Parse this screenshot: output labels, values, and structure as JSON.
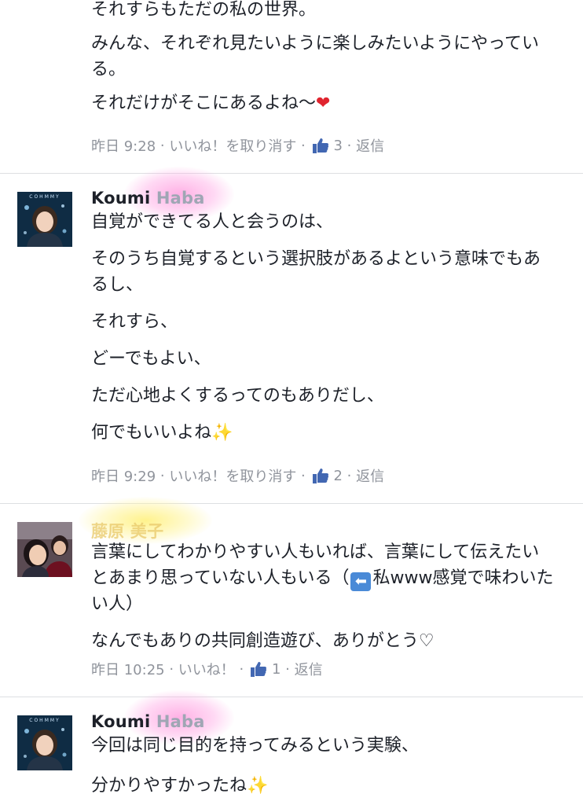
{
  "comments": [
    {
      "author": "",
      "lines": [
        "それすらもただの私の世界。",
        "みんな、それぞれ見たいように楽しみたいようにやっている。",
        "それだけがそこにあるよね〜"
      ],
      "time": "昨日 9:28",
      "like_action": "いいね！を取り消す",
      "like_count": "3",
      "reply": "返信"
    },
    {
      "author_first": "Koumi",
      "author_rest": "Haba",
      "lines": [
        "自覚ができてる人と会うのは、",
        "そのうち自覚するという選択肢があるよという意味でもあるし、",
        "それすら、",
        "どーでもよい、",
        "ただ心地よくするってのもありだし、",
        "何でもいいよね"
      ],
      "time": "昨日 9:29",
      "like_action": "いいね！を取り消す",
      "like_count": "2",
      "reply": "返信"
    },
    {
      "author_blurred": "藤原 美子",
      "lines_a": [
        "言葉にしてわかりやすい人もいれば、言葉にして伝えたいとあまり思っていない人もいる（",
        "私www感覚で味わいたい人）"
      ],
      "line_b": "なんでもありの共同創造遊び、ありがとう♡",
      "time": "昨日 10:25",
      "like_action": "いいね！",
      "like_count": "1",
      "reply": "返信"
    },
    {
      "author_first": "Koumi",
      "author_rest": "Haba",
      "lines": [
        "今回は同じ目的を持ってみるという実験、",
        "分かりやすかったね"
      ]
    }
  ],
  "avatar_label": "COHMMY",
  "icons": {
    "heart": "heart-emoji",
    "sparkles": "sparkles-emoji",
    "thumb": "like-thumb-icon",
    "arrow": "left-arrow-emoji"
  },
  "colors": {
    "meta": "#90949c",
    "link_blue": "#4267b2",
    "divider": "#dddfe2"
  }
}
